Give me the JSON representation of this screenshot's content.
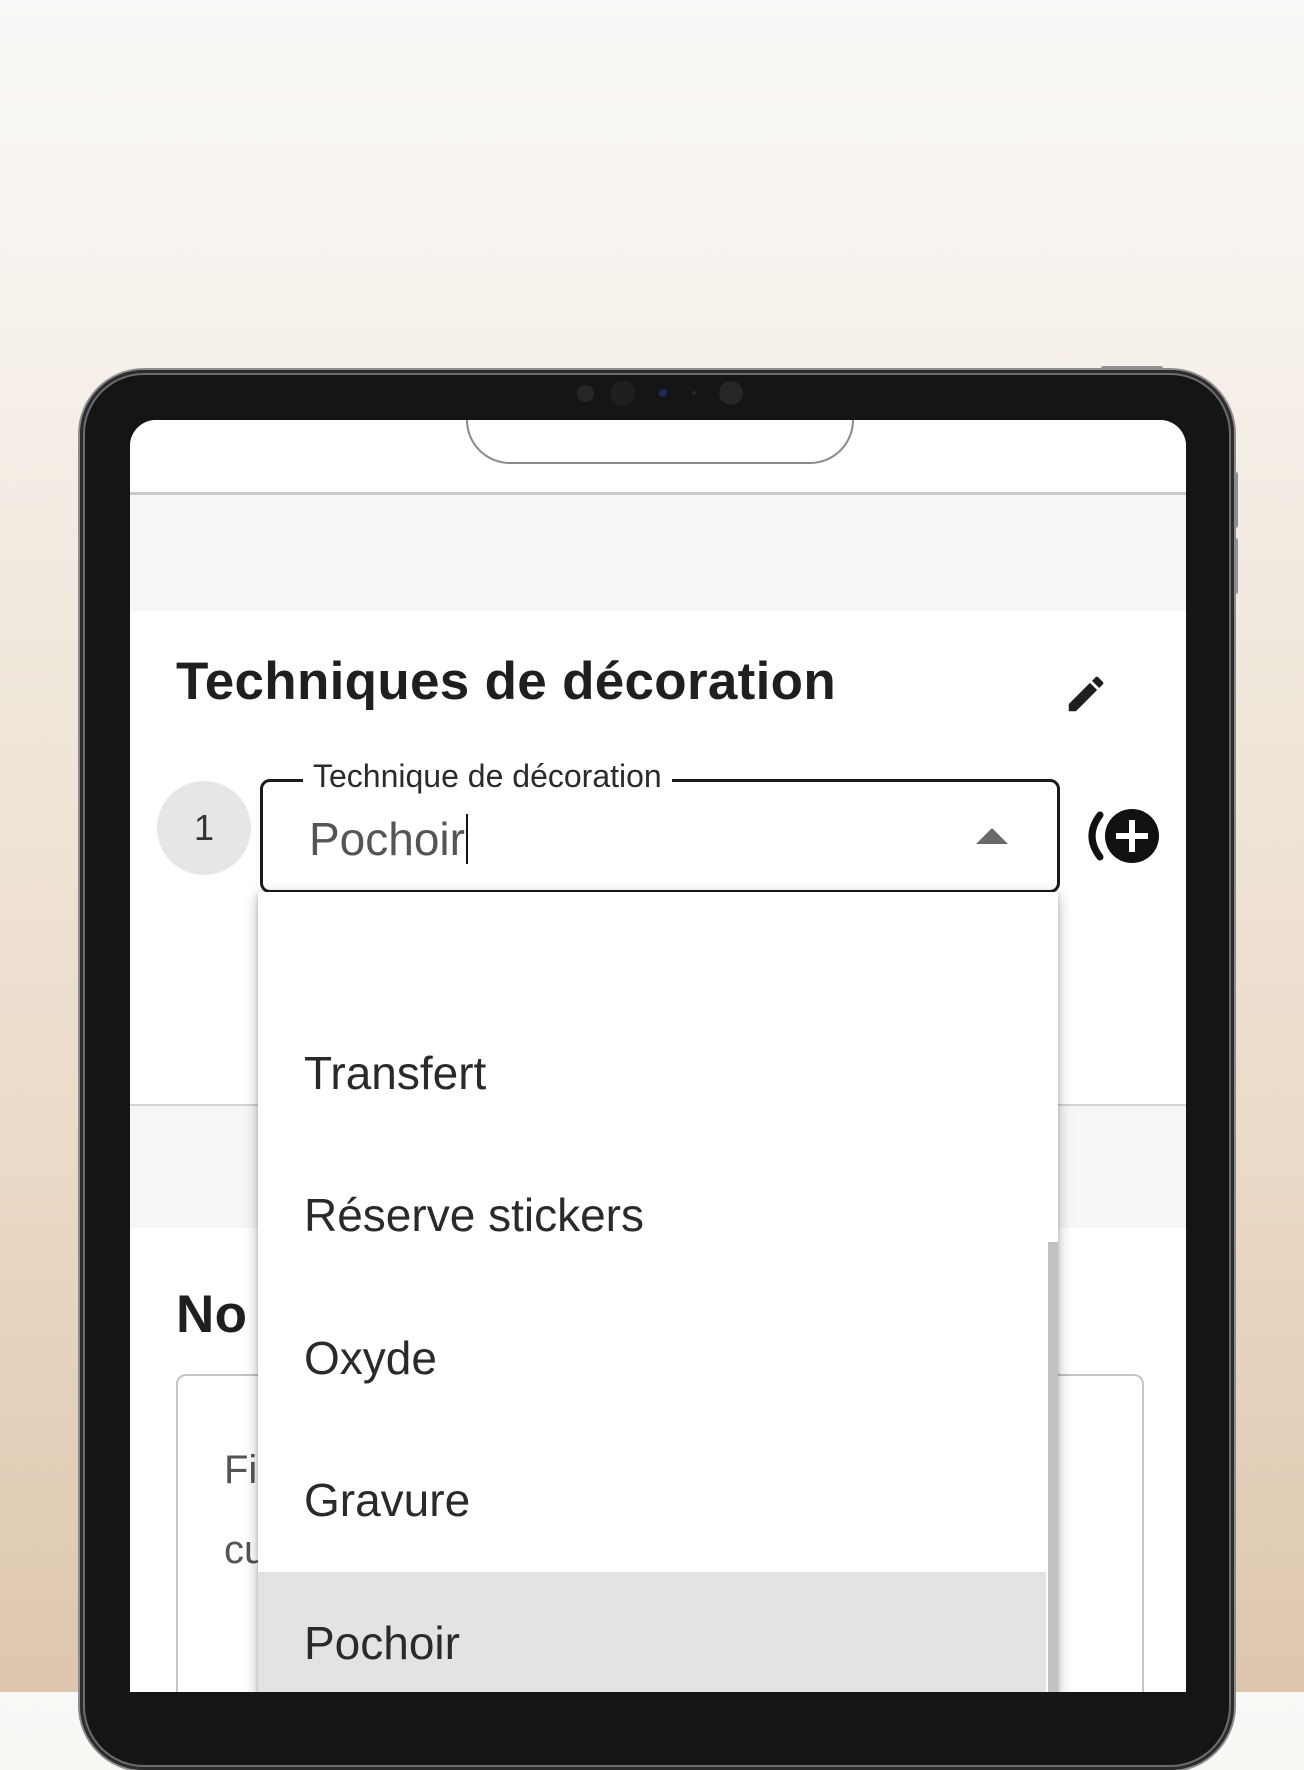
{
  "techniques_section": {
    "title": "Techniques de décoration",
    "step_number": "1",
    "field": {
      "label": "Technique de décoration",
      "value": "Pochoir"
    },
    "add_symbol": "(",
    "dropdown_options": [
      {
        "label": "Transfert",
        "selected": false
      },
      {
        "label": "Réserve stickers",
        "selected": false
      },
      {
        "label": "Oxyde",
        "selected": false
      },
      {
        "label": "Gravure",
        "selected": false
      },
      {
        "label": "Pochoir",
        "selected": true
      }
    ]
  },
  "notes_section": {
    "title_visible": "No",
    "text_line_1_visible": "Fi",
    "text_line_2_visible": "cu"
  },
  "icons": {
    "edit": "pencil-icon",
    "add": "plus-circle-icon",
    "dropdown": "triangle-up-icon"
  },
  "colors": {
    "text_dark": "#1f1f1f",
    "selected_option_bg": "#e3e3e3",
    "device_frame": "#151515"
  }
}
